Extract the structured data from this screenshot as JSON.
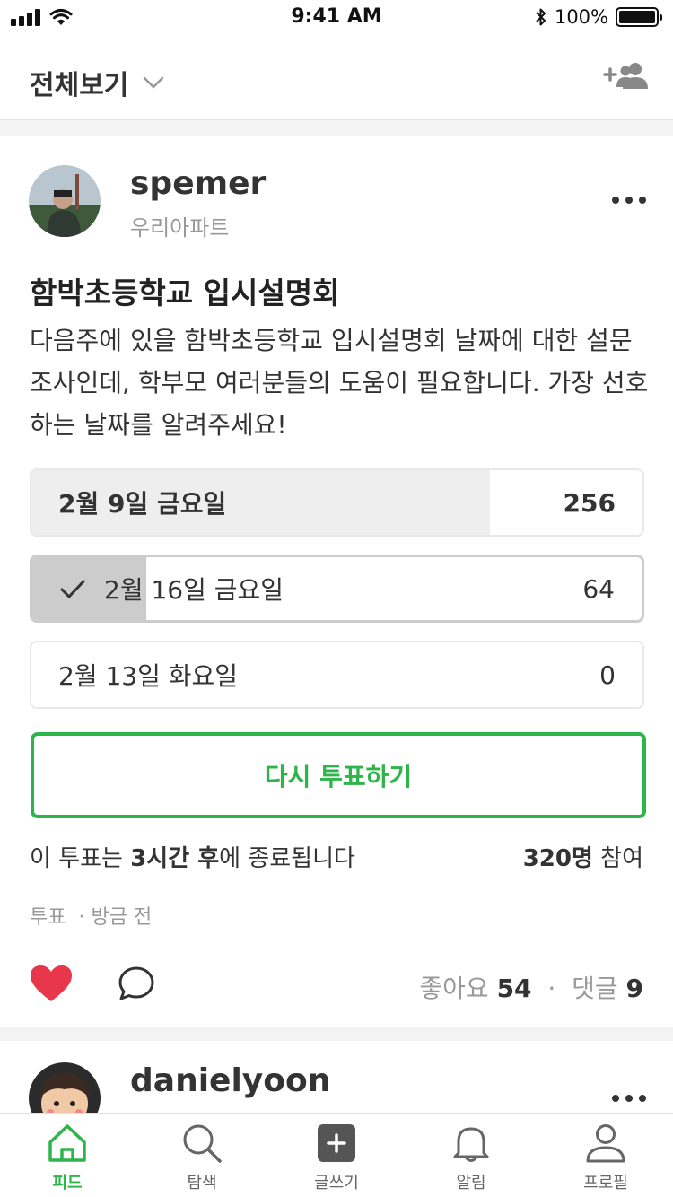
{
  "status_bar": {
    "time": "9:41 AM",
    "battery": "100%"
  },
  "top_nav": {
    "title": "전체보기"
  },
  "post": {
    "username": "spemer",
    "group": "우리아파트",
    "title": "함박초등학교 입시설명회",
    "body": "다음주에 있을 함박초등학교 입시설명회 날짜에 대한 설문조사인데, 학부모 여러분들의 도움이 필요합니다. 가장 선호하는 날짜를 알려주세요!",
    "poll": {
      "options": [
        {
          "label": "2월 9일 금요일",
          "count": "256",
          "share": 0.75,
          "selected": false,
          "winner": true
        },
        {
          "label": "2월 16일 금요일",
          "count": "64",
          "share": 0.187,
          "selected": true,
          "winner": false
        },
        {
          "label": "2월 13일 화요일",
          "count": "0",
          "share": 0,
          "selected": false,
          "winner": false
        }
      ],
      "revote_label": "다시 투표하기",
      "ends_prefix": "이 투표는 ",
      "ends_time": "3시간 후",
      "ends_suffix": "에 종료됩니다",
      "participants": "320명",
      "participants_suffix": " 참여"
    },
    "meta": {
      "type": "투표",
      "separator": "·",
      "time": "방금 전"
    },
    "likes_label": "좋아요",
    "likes": "54",
    "stats_separator": "·",
    "comments_label": "댓글",
    "comments": "9"
  },
  "next_post": {
    "username": "danielyoon"
  },
  "tab_bar": {
    "tabs": [
      {
        "label": "피드",
        "icon": "home-icon",
        "active": true
      },
      {
        "label": "탐색",
        "icon": "search-icon",
        "active": false
      },
      {
        "label": "글쓰기",
        "icon": "compose-icon",
        "active": false
      },
      {
        "label": "알림",
        "icon": "bell-icon",
        "active": false
      },
      {
        "label": "프로필",
        "icon": "profile-icon",
        "active": false
      }
    ]
  },
  "colors": {
    "accent": "#2db54a",
    "heart": "#e8374a",
    "winner_bar": "#eeeeee",
    "selected_bar": "#cccccc"
  }
}
